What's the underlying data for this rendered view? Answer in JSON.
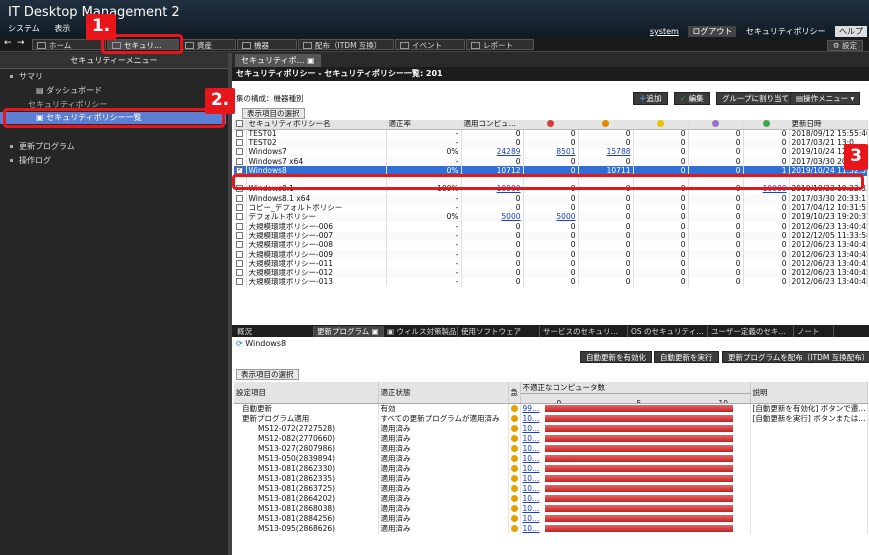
{
  "app": {
    "title": "IT Desktop Management 2",
    "menu": [
      "システム",
      "表示"
    ]
  },
  "toolbar": {
    "buttons": [
      "ホーム",
      "セキュリ…",
      "資産",
      "機器",
      "配布（ITDM 互換）",
      "イベント",
      "レポート"
    ],
    "settings": "設定"
  },
  "header_right": {
    "user": "system",
    "logout": "ログアウト",
    "policy": "セキュリティポリシー",
    "help": "ヘルプ"
  },
  "sidebar": {
    "title": "セキュリティーメニュー",
    "items": [
      "サマリ",
      "ダッシュボード",
      "セキュリティポリシー",
      "セキュリティポリシー一覧",
      "更新プログラム",
      "操作ログ"
    ]
  },
  "main": {
    "tab": "セキュリティポ…",
    "breadcrumb": "セキュリティポリシー - セキュリティポリシー一覧",
    "count": ": 201",
    "group_label": "集の構成：機器種別",
    "actions": [
      "追加",
      "編集",
      "グループに割り当て",
      "操作メニュー"
    ],
    "column_select": "表示項目の選択",
    "columns": [
      "セキュリティポリシー名",
      "適正率",
      "適用コンピュ…",
      "",
      "",
      "",
      "",
      "",
      "更新日時"
    ],
    "rows": [
      {
        "name": "TEST01",
        "rate": "-",
        "total": "0",
        "c1": "0",
        "c2": "0",
        "c3": "0",
        "c4": "0",
        "c5": "0",
        "date": "2018/09/12 15:55:40"
      },
      {
        "name": "TEST02",
        "rate": "-",
        "total": "0",
        "c1": "0",
        "c2": "0",
        "c3": "0",
        "c4": "0",
        "c5": "0",
        "date": "2017/03/21 13:0"
      },
      {
        "name": "Windows7",
        "rate": "0%",
        "total": "24289",
        "c1": "8501",
        "c2": "15788",
        "c3": "0",
        "c4": "0",
        "c5": "0",
        "date": "2019/10/24 12:3"
      },
      {
        "name": "Windows7 x64",
        "rate": "-",
        "total": "0",
        "c1": "0",
        "c2": "0",
        "c3": "0",
        "c4": "0",
        "c5": "0",
        "date": "2017/03/30 20:3"
      },
      {
        "name": "Windows8",
        "rate": "0%",
        "total": "10712",
        "c1": "0",
        "c2": "10711",
        "c3": "0",
        "c4": "0",
        "c5": "1",
        "date": "2019/10/24 11:52:57"
      },
      {
        "name": "",
        "rate": "",
        "total": "",
        "c1": "",
        "c2": "",
        "c3": "",
        "c4": "",
        "c5": "",
        "date": ""
      },
      {
        "name": "Windows8.1",
        "rate": "100%",
        "total": "10000",
        "c1": "0",
        "c2": "0",
        "c3": "0",
        "c4": "0",
        "c5": "10000",
        "date": "2019/10/23 19:22:33"
      },
      {
        "name": "Windows8.1 x64",
        "rate": "-",
        "total": "0",
        "c1": "0",
        "c2": "0",
        "c3": "0",
        "c4": "0",
        "c5": "0",
        "date": "2017/03/30 20:33:11"
      },
      {
        "name": "コピー_デフォルトポリシー",
        "rate": "-",
        "total": "0",
        "c1": "0",
        "c2": "0",
        "c3": "0",
        "c4": "0",
        "c5": "0",
        "date": "2017/04/12 10:31:51"
      },
      {
        "name": "デフォルトポリシー",
        "rate": "0%",
        "total": "5000",
        "c1": "5000",
        "c2": "0",
        "c3": "0",
        "c4": "0",
        "c5": "0",
        "date": "2019/10/23 19:20:37"
      },
      {
        "name": "大規模環境ポリシー-006",
        "rate": "-",
        "total": "0",
        "c1": "0",
        "c2": "0",
        "c3": "0",
        "c4": "0",
        "c5": "0",
        "date": "2012/06/23 13:40:45"
      },
      {
        "name": "大規模環境ポリシー-007",
        "rate": "-",
        "total": "0",
        "c1": "0",
        "c2": "0",
        "c3": "0",
        "c4": "0",
        "c5": "0",
        "date": "2012/12/05 11:33:58"
      },
      {
        "name": "大規模環境ポリシー-008",
        "rate": "-",
        "total": "0",
        "c1": "0",
        "c2": "0",
        "c3": "0",
        "c4": "0",
        "c5": "0",
        "date": "2012/06/23 13:40:45"
      },
      {
        "name": "大規模環境ポリシー-009",
        "rate": "-",
        "total": "0",
        "c1": "0",
        "c2": "0",
        "c3": "0",
        "c4": "0",
        "c5": "0",
        "date": "2012/06/23 13:40:45"
      },
      {
        "name": "大規模環境ポリシー-011",
        "rate": "-",
        "total": "0",
        "c1": "0",
        "c2": "0",
        "c3": "0",
        "c4": "0",
        "c5": "0",
        "date": "2012/06/23 13:40:45"
      },
      {
        "name": "大規模環境ポリシー-012",
        "rate": "-",
        "total": "0",
        "c1": "0",
        "c2": "0",
        "c3": "0",
        "c4": "0",
        "c5": "0",
        "date": "2012/06/23 13:40:45"
      },
      {
        "name": "大規模環境ポリシー-013",
        "rate": "-",
        "total": "0",
        "c1": "0",
        "c2": "0",
        "c3": "0",
        "c4": "0",
        "c5": "0",
        "date": "2012/06/23 13:40:45"
      }
    ]
  },
  "detail": {
    "tabs": [
      "概況",
      "更新プログラム",
      "ウィルス対策製品",
      "使用ソフトウェア",
      "サービスのセキュリ…",
      "OS のセキュリティ…",
      "ユーザー定義のセキ…",
      "ノート"
    ],
    "title": "Windows8",
    "buttons": [
      "自動更新を有効化",
      "自動更新を実行",
      "更新プログラムを配布（ITDM 互換配布）"
    ],
    "column_select": "表示項目の選択",
    "columns": [
      "設定項目",
      "適正状態",
      "急",
      "不適正なコンピュータ数",
      "説明"
    ],
    "scale": [
      "0",
      "5",
      "10"
    ],
    "rows": [
      {
        "item": "自動更新",
        "state": "有効",
        "count": "99…",
        "bar": 0.95,
        "desc": "[自動更新を有効化] ボタンで遷…"
      },
      {
        "item": "更新プログラム適用",
        "state": "すべての更新プログラムが適用済み",
        "count": "10…",
        "bar": 0.95,
        "desc": "[自動更新を実行] ボタンまたは…"
      },
      {
        "item": "MS12-072(2727528)",
        "state": "適用済み",
        "count": "10…",
        "bar": 0.95,
        "desc": ""
      },
      {
        "item": "MS12-082(2770660)",
        "state": "適用済み",
        "count": "10…",
        "bar": 0.95,
        "desc": ""
      },
      {
        "item": "MS13-027(2807986)",
        "state": "適用済み",
        "count": "10…",
        "bar": 0.95,
        "desc": ""
      },
      {
        "item": "MS13-050(2839894)",
        "state": "適用済み",
        "count": "10…",
        "bar": 0.95,
        "desc": ""
      },
      {
        "item": "MS13-081(2862330)",
        "state": "適用済み",
        "count": "10…",
        "bar": 0.95,
        "desc": ""
      },
      {
        "item": "MS13-081(2862335)",
        "state": "適用済み",
        "count": "10…",
        "bar": 0.95,
        "desc": ""
      },
      {
        "item": "MS13-081(2863725)",
        "state": "適用済み",
        "count": "10…",
        "bar": 0.95,
        "desc": ""
      },
      {
        "item": "MS13-081(2864202)",
        "state": "適用済み",
        "count": "10…",
        "bar": 0.95,
        "desc": ""
      },
      {
        "item": "MS13-081(2868038)",
        "state": "適用済み",
        "count": "10…",
        "bar": 0.95,
        "desc": ""
      },
      {
        "item": "MS13-081(2884256)",
        "state": "適用済み",
        "count": "10…",
        "bar": 0.95,
        "desc": ""
      },
      {
        "item": "MS13-095(2868626)",
        "state": "適用済み",
        "count": "10…",
        "bar": 0.95,
        "desc": ""
      }
    ]
  },
  "callouts": [
    "1.",
    "2.",
    "3"
  ],
  "colors": {
    "highlight": "#e8151a",
    "selection": "#2f6fd6",
    "bar": "#c02323"
  }
}
